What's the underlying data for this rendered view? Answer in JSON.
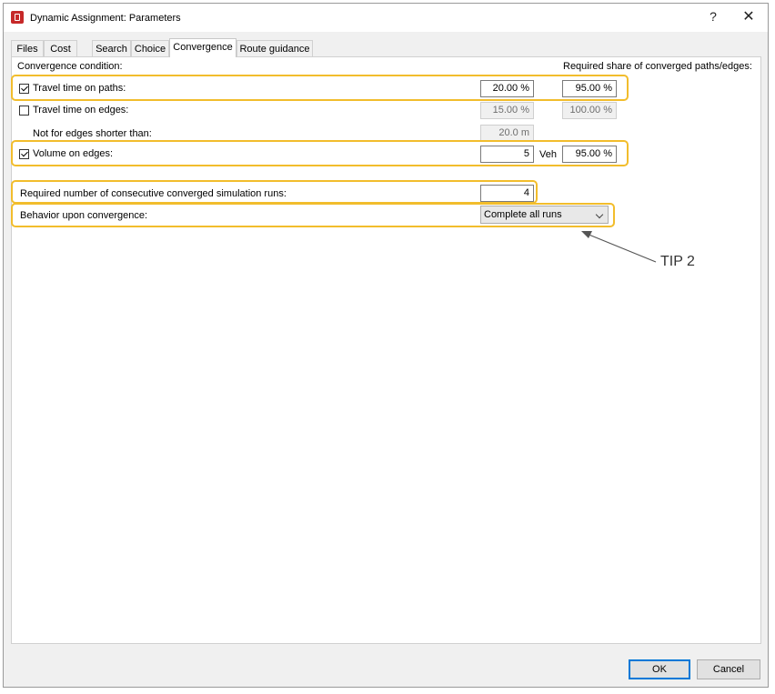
{
  "window": {
    "title": "Dynamic Assignment: Parameters",
    "help_label": "?",
    "close_label": "✕"
  },
  "tabs": [
    {
      "label": "Files"
    },
    {
      "label": "Cost"
    },
    {
      "label": "Search"
    },
    {
      "label": "Choice"
    },
    {
      "label": "Convergence",
      "active": true
    },
    {
      "label": "Route guidance"
    }
  ],
  "convergence": {
    "condition_label": "Convergence condition:",
    "share_header": "Required share of converged paths/edges:",
    "travel_time_paths": {
      "label": "Travel time on paths:",
      "checked": true,
      "value": "20.00 %",
      "share": "95.00 %"
    },
    "travel_time_edges": {
      "label": "Travel time on edges:",
      "checked": false,
      "value": "15.00 %",
      "share": "100.00 %"
    },
    "not_shorter": {
      "label": "Not for edges shorter than:",
      "value": "20.0 m"
    },
    "volume_edges": {
      "label": "Volume on edges:",
      "checked": true,
      "value": "5",
      "unit": "Veh",
      "share": "95.00 %"
    },
    "consecutive_runs": {
      "label": "Required number of consecutive converged simulation runs:",
      "value": "4"
    },
    "behavior": {
      "label": "Behavior upon convergence:",
      "selected": "Complete all runs"
    }
  },
  "annotation": {
    "tip_label": "TIP 2",
    "highlight_color": "#f2bd2c"
  },
  "footer": {
    "ok_label": "OK",
    "cancel_label": "Cancel"
  }
}
